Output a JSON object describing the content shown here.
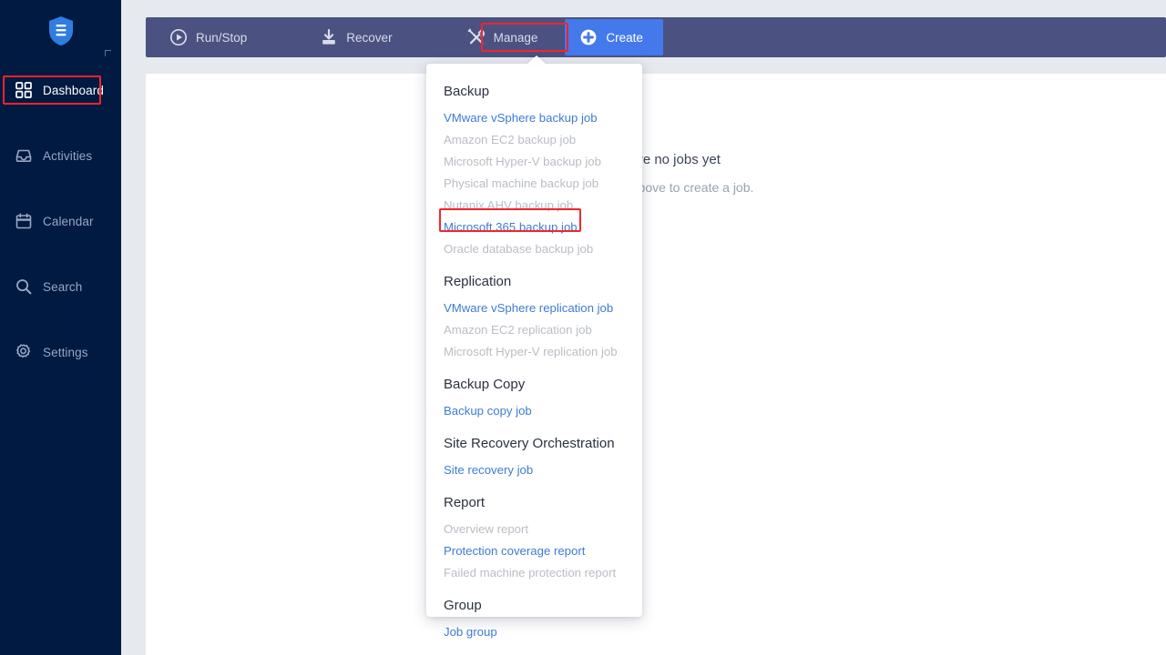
{
  "app": {
    "logo_name": "shield-logo"
  },
  "sidebar": {
    "items": [
      {
        "label": "Dashboard",
        "icon": "grid-icon",
        "active": true
      },
      {
        "label": "Activities",
        "icon": "inbox-icon",
        "active": false
      },
      {
        "label": "Calendar",
        "icon": "calendar-icon",
        "active": false
      },
      {
        "label": "Search",
        "icon": "search-icon",
        "active": false
      },
      {
        "label": "Settings",
        "icon": "gear-icon",
        "active": false
      }
    ]
  },
  "toolbar": {
    "run_stop_label": "Run/Stop",
    "recover_label": "Recover",
    "manage_label": "Manage",
    "create_label": "Create",
    "icons": {
      "run_stop": "play-circle-icon",
      "recover": "download-tray-icon",
      "manage": "tools-icon",
      "create": "plus-circle-icon"
    },
    "background_color": "#4b5180",
    "create_color": "#4479ec"
  },
  "content": {
    "empty_title": "There are no jobs yet",
    "empty_subtitle": "Click Create above to create a job."
  },
  "create_menu": {
    "groups": [
      {
        "title": "Backup",
        "items": [
          {
            "label": "VMware vSphere backup job",
            "enabled": true
          },
          {
            "label": "Amazon EC2 backup job",
            "enabled": false
          },
          {
            "label": "Microsoft Hyper-V backup job",
            "enabled": false
          },
          {
            "label": "Physical machine backup job",
            "enabled": false
          },
          {
            "label": "Nutanix AHV backup job",
            "enabled": false
          },
          {
            "label": "Microsoft 365 backup job",
            "enabled": true
          },
          {
            "label": "Oracle database backup job",
            "enabled": false
          }
        ]
      },
      {
        "title": "Replication",
        "items": [
          {
            "label": "VMware vSphere replication job",
            "enabled": true
          },
          {
            "label": "Amazon EC2 replication job",
            "enabled": false
          },
          {
            "label": "Microsoft Hyper-V replication job",
            "enabled": false
          }
        ]
      },
      {
        "title": "Backup Copy",
        "items": [
          {
            "label": "Backup copy job",
            "enabled": true
          }
        ]
      },
      {
        "title": "Site Recovery Orchestration",
        "items": [
          {
            "label": "Site recovery job",
            "enabled": true
          }
        ]
      },
      {
        "title": "Report",
        "items": [
          {
            "label": "Overview report",
            "enabled": false
          },
          {
            "label": "Protection coverage report",
            "enabled": true
          },
          {
            "label": "Failed machine protection report",
            "enabled": false
          }
        ]
      },
      {
        "title": "Group",
        "items": [
          {
            "label": "Job group",
            "enabled": true
          }
        ]
      }
    ]
  },
  "annotations": {
    "color": "#f4252b",
    "targets": [
      "Dashboard",
      "Create",
      "Microsoft 365 backup job"
    ]
  }
}
